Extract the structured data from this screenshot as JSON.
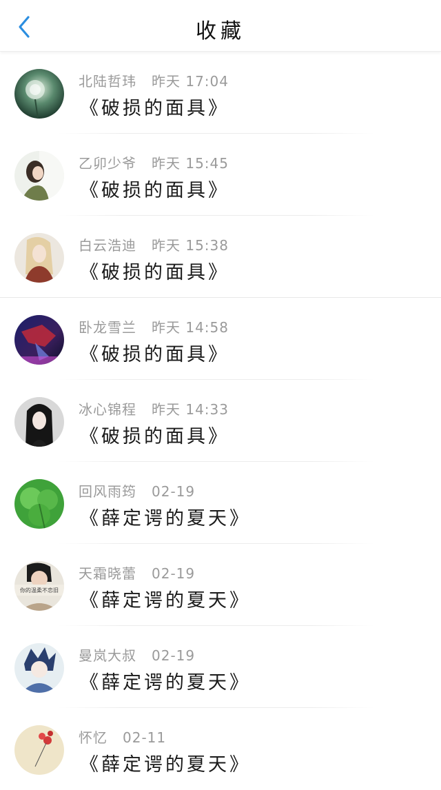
{
  "header": {
    "title": "收藏",
    "back_icon": "chevron-left-icon",
    "accent": "#2b8ee0"
  },
  "items": [
    {
      "user": "北陆哲玮",
      "time": "昨天 17:04",
      "title": "《破损的面具》"
    },
    {
      "user": "乙卯少爷",
      "time": "昨天 15:45",
      "title": "《破损的面具》"
    },
    {
      "user": "白云浩迪",
      "time": "昨天 15:38",
      "title": "《破损的面具》"
    },
    {
      "user": "卧龙雪兰",
      "time": "昨天 14:58",
      "title": "《破损的面具》"
    },
    {
      "user": "冰心锦程",
      "time": "昨天 14:33",
      "title": "《破损的面具》"
    },
    {
      "user": "回风雨筠",
      "time": "02-19",
      "title": "《薛定谔的夏天》"
    },
    {
      "user": "天霜晓蕾",
      "time": "02-19",
      "title": "《薛定谔的夏天》",
      "avatar_caption": "你的温柔不恋旧"
    },
    {
      "user": "曼岚大叔",
      "time": "02-19",
      "title": "《薛定谔的夏天》"
    },
    {
      "user": "怀忆",
      "time": "02-11",
      "title": "《薛定谔的夏天》"
    }
  ]
}
